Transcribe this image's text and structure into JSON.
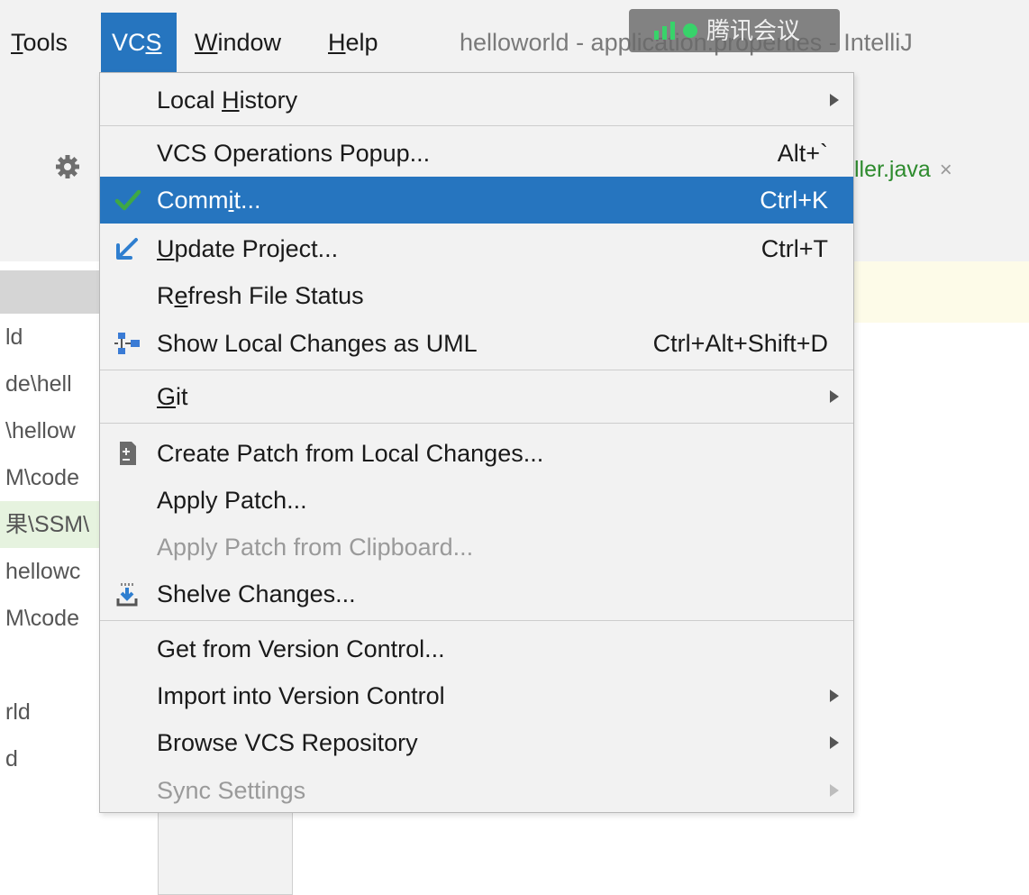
{
  "menubar": {
    "tools": {
      "before": "",
      "mnemonic": "T",
      "after": "ools"
    },
    "vcs": {
      "before": "VC",
      "mnemonic": "S",
      "after": ""
    },
    "window": {
      "before": "",
      "mnemonic": "W",
      "after": "indow"
    },
    "help": {
      "before": "",
      "mnemonic": "H",
      "after": "elp"
    },
    "window_title": "helloworld - application.properties - IntelliJ"
  },
  "meeting_badge": {
    "text": "腾讯会议",
    "accent": "#38d36a"
  },
  "editor_tab": {
    "label": "ller.java",
    "close": "×"
  },
  "left_panel": {
    "rows": [
      "ld",
      "de\\hell",
      "\\hellow",
      "M\\code",
      "果\\SSM\\",
      "hellowc",
      "M\\code",
      "",
      "rld",
      "d"
    ]
  },
  "colors": {
    "selection": "#2675bf",
    "menu_bg": "#f2f2f2",
    "check_green": "#3ea845",
    "update_blue": "#2f7fd0"
  },
  "vcs_menu": {
    "local_history": {
      "before": "Local ",
      "mnemonic": "H",
      "after": "istory"
    },
    "vcs_ops": {
      "label": "VCS Operations Popup...",
      "shortcut": "Alt+`"
    },
    "commit": {
      "before": "Comm",
      "mnemonic": "i",
      "after": "t...",
      "shortcut": "Ctrl+K",
      "icon": "check-icon"
    },
    "update": {
      "before": "",
      "mnemonic": "U",
      "after": "pdate Project...",
      "shortcut": "Ctrl+T",
      "icon": "update-arrow-icon"
    },
    "refresh": {
      "before": "R",
      "mnemonic": "e",
      "after": "fresh File Status"
    },
    "uml": {
      "label": "Show Local Changes as UML",
      "shortcut": "Ctrl+Alt+Shift+D",
      "icon": "uml-diagram-icon"
    },
    "git": {
      "before": "",
      "mnemonic": "G",
      "after": "it"
    },
    "create_patch": {
      "label": "Create Patch from Local Changes...",
      "icon": "patch-icon"
    },
    "apply_patch": {
      "label": "Apply Patch..."
    },
    "apply_clipboard": {
      "label": "Apply Patch from Clipboard..."
    },
    "shelve": {
      "label": "Shelve Changes...",
      "icon": "shelve-icon"
    },
    "get_vc": {
      "label": "Get from Version Control..."
    },
    "import_vc": {
      "label": "Import into Version Control"
    },
    "browse_vcs": {
      "label": "Browse VCS Repository"
    },
    "sync": {
      "label": "Sync Settings"
    }
  }
}
